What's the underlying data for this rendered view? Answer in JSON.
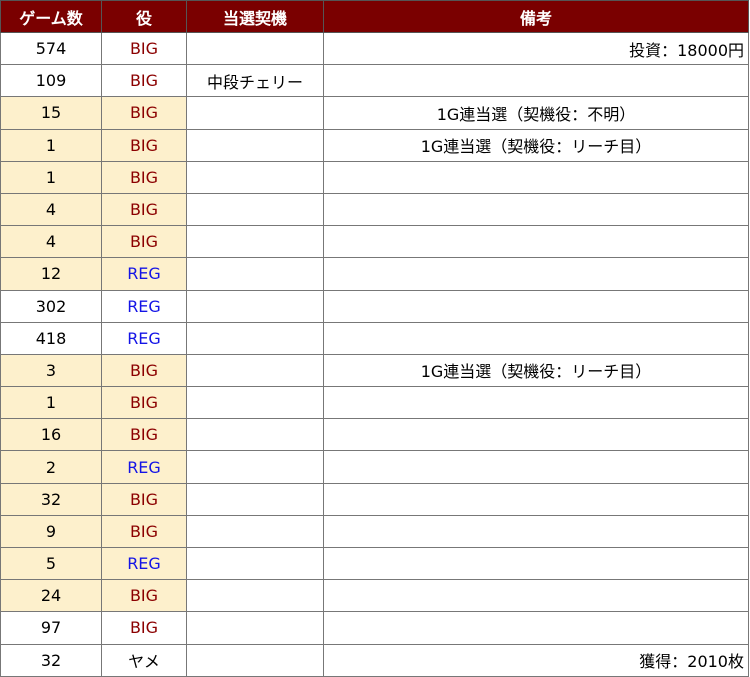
{
  "headers": {
    "game": "ゲーム数",
    "role": "役",
    "trigger": "当選契機",
    "note": "備考"
  },
  "rows": [
    {
      "game": "574",
      "role": "BIG",
      "trigger": "",
      "note": "投資：18000円",
      "align": "right",
      "hl": false,
      "cls": "big"
    },
    {
      "game": "109",
      "role": "BIG",
      "trigger": "中段チェリー",
      "note": "",
      "align": "center",
      "hl": false,
      "cls": "big"
    },
    {
      "game": "15",
      "role": "BIG",
      "trigger": "",
      "note": "1G連当選（契機役：不明）",
      "align": "center",
      "hl": true,
      "cls": "big"
    },
    {
      "game": "1",
      "role": "BIG",
      "trigger": "",
      "note": "1G連当選（契機役：リーチ目）",
      "align": "center",
      "hl": true,
      "cls": "big"
    },
    {
      "game": "1",
      "role": "BIG",
      "trigger": "",
      "note": "",
      "align": "center",
      "hl": true,
      "cls": "big"
    },
    {
      "game": "4",
      "role": "BIG",
      "trigger": "",
      "note": "",
      "align": "center",
      "hl": true,
      "cls": "big"
    },
    {
      "game": "4",
      "role": "BIG",
      "trigger": "",
      "note": "",
      "align": "center",
      "hl": true,
      "cls": "big"
    },
    {
      "game": "12",
      "role": "REG",
      "trigger": "",
      "note": "",
      "align": "center",
      "hl": true,
      "cls": "reg"
    },
    {
      "game": "302",
      "role": "REG",
      "trigger": "",
      "note": "",
      "align": "center",
      "hl": false,
      "cls": "reg"
    },
    {
      "game": "418",
      "role": "REG",
      "trigger": "",
      "note": "",
      "align": "center",
      "hl": false,
      "cls": "reg"
    },
    {
      "game": "3",
      "role": "BIG",
      "trigger": "",
      "note": "1G連当選（契機役：リーチ目）",
      "align": "center",
      "hl": true,
      "cls": "big"
    },
    {
      "game": "1",
      "role": "BIG",
      "trigger": "",
      "note": "",
      "align": "center",
      "hl": true,
      "cls": "big"
    },
    {
      "game": "16",
      "role": "BIG",
      "trigger": "",
      "note": "",
      "align": "center",
      "hl": true,
      "cls": "big"
    },
    {
      "game": "2",
      "role": "REG",
      "trigger": "",
      "note": "",
      "align": "center",
      "hl": true,
      "cls": "reg"
    },
    {
      "game": "32",
      "role": "BIG",
      "trigger": "",
      "note": "",
      "align": "center",
      "hl": true,
      "cls": "big"
    },
    {
      "game": "9",
      "role": "BIG",
      "trigger": "",
      "note": "",
      "align": "center",
      "hl": true,
      "cls": "big"
    },
    {
      "game": "5",
      "role": "REG",
      "trigger": "",
      "note": "",
      "align": "center",
      "hl": true,
      "cls": "reg"
    },
    {
      "game": "24",
      "role": "BIG",
      "trigger": "",
      "note": "",
      "align": "center",
      "hl": true,
      "cls": "big"
    },
    {
      "game": "97",
      "role": "BIG",
      "trigger": "",
      "note": "",
      "align": "center",
      "hl": false,
      "cls": "big"
    },
    {
      "game": "32",
      "role": "ヤメ",
      "trigger": "",
      "note": "獲得：2010枚",
      "align": "right",
      "hl": false,
      "cls": "yame"
    }
  ],
  "colors": {
    "header_bg": "#7a0000",
    "highlight": "#fdf0cc",
    "big": "#8b0000",
    "reg": "#1414e6"
  }
}
